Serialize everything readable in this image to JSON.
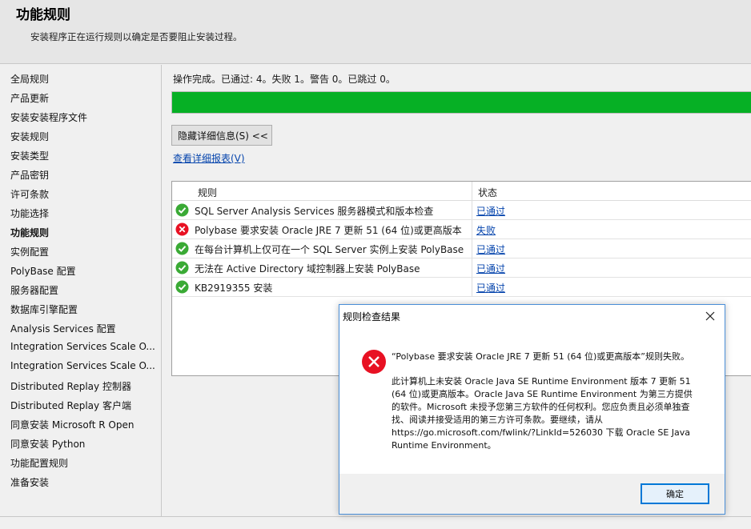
{
  "header": {
    "title": "功能规则",
    "subtitle": "安装程序正在运行规则以确定是否要阻止安装过程。"
  },
  "sidebar": {
    "items": [
      {
        "label": "全局规则"
      },
      {
        "label": "产品更新"
      },
      {
        "label": "安装安装程序文件"
      },
      {
        "label": "安装规则"
      },
      {
        "label": "安装类型"
      },
      {
        "label": "产品密钥"
      },
      {
        "label": "许可条款"
      },
      {
        "label": "功能选择"
      },
      {
        "label": "功能规则",
        "active": true
      },
      {
        "label": "实例配置"
      },
      {
        "label": "PolyBase 配置"
      },
      {
        "label": "服务器配置"
      },
      {
        "label": "数据库引擎配置"
      },
      {
        "label": "Analysis Services 配置"
      },
      {
        "label": "Integration Services Scale O..."
      },
      {
        "label": "Integration Services Scale O..."
      },
      {
        "label": "Distributed Replay 控制器"
      },
      {
        "label": "Distributed Replay 客户端"
      },
      {
        "label": "同意安装 Microsoft R Open"
      },
      {
        "label": "同意安装 Python"
      },
      {
        "label": "功能配置规则"
      },
      {
        "label": "准备安装"
      }
    ]
  },
  "main": {
    "status_text": "操作完成。已通过: 4。失败 1。警告 0。已跳过 0。",
    "progress": 1.0,
    "hide_details_label": "隐藏详细信息(S) <<",
    "view_report_label": "查看详细报表(V)",
    "table": {
      "columns": [
        "规则",
        "状态"
      ],
      "rows": [
        {
          "rule": "SQL Server Analysis Services 服务器模式和版本检查",
          "status": "已通过",
          "icon": "check-icon"
        },
        {
          "rule": "Polybase 要求安装 Oracle JRE 7 更新 51 (64 位)或更高版本",
          "status": "失败",
          "icon": "error-icon"
        },
        {
          "rule": "在每台计算机上仅可在一个 SQL Server 实例上安装 PolyBase",
          "status": "已通过",
          "icon": "check-icon"
        },
        {
          "rule": "无法在 Active Directory 域控制器上安装 PolyBase",
          "status": "已通过",
          "icon": "check-icon"
        },
        {
          "rule": "KB2919355 安装",
          "status": "已通过",
          "icon": "check-icon"
        }
      ]
    }
  },
  "dialog": {
    "title": "规则检查结果",
    "message1": "“Polybase 要求安装 Oracle JRE 7 更新 51 (64 位)或更高版本”规则失败。",
    "message2": "此计算机上未安装 Oracle Java SE Runtime Environment 版本 7 更新 51 (64 位)或更高版本。Oracle Java SE Runtime Environment 为第三方提供的软件。Microsoft 未授予您第三方软件的任何权利。您应负责且必须单独查找、阅读并接受适用的第三方许可条款。要继续，请从 https://go.microsoft.com/fwlink/?LinkId=526030 下载 Oracle SE Java Runtime Environment。",
    "ok_label": "确定"
  },
  "colors": {
    "progress_green": "#06b025",
    "link_blue": "#0645ad",
    "success_green": "#3aaa35",
    "error_red": "#e81123",
    "dialog_border": "#4a8fd8"
  }
}
